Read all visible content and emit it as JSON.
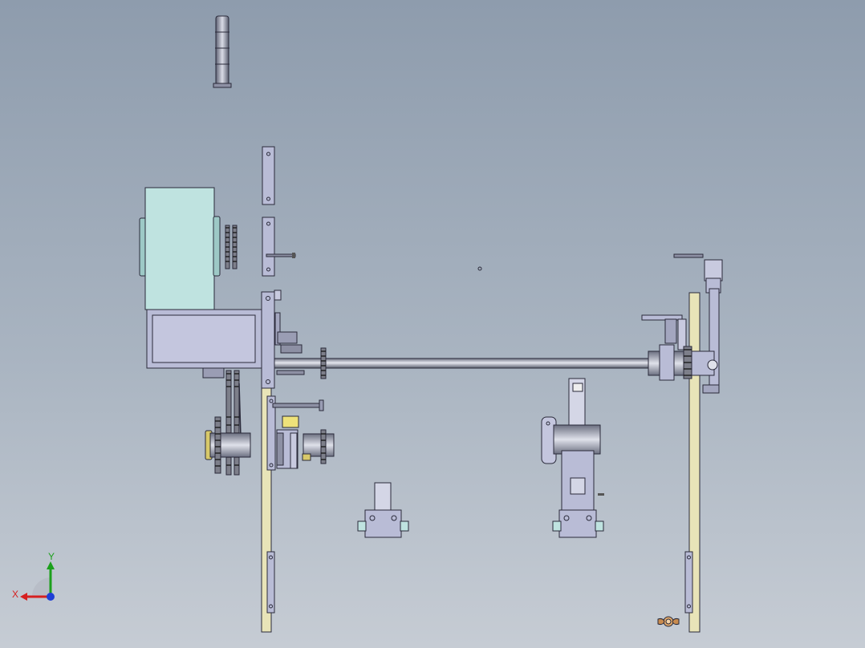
{
  "colors": {
    "background_top": "#8e9cad",
    "background_bottom": "#c6ccd4",
    "part_fill": "#b9bcd6",
    "part_stroke": "#2a2a3a",
    "motor_fill": "#bfe3e0",
    "frame_fill": "#e8e4b8",
    "axis_x": "#d62020",
    "axis_y": "#1ca01c",
    "axis_z": "#1f3fd6"
  },
  "triad": {
    "x_label": "X",
    "y_label": "Y"
  },
  "icons": {
    "triad": "coordinate-triad-icon",
    "wing_nut": "wing-nut-icon"
  }
}
